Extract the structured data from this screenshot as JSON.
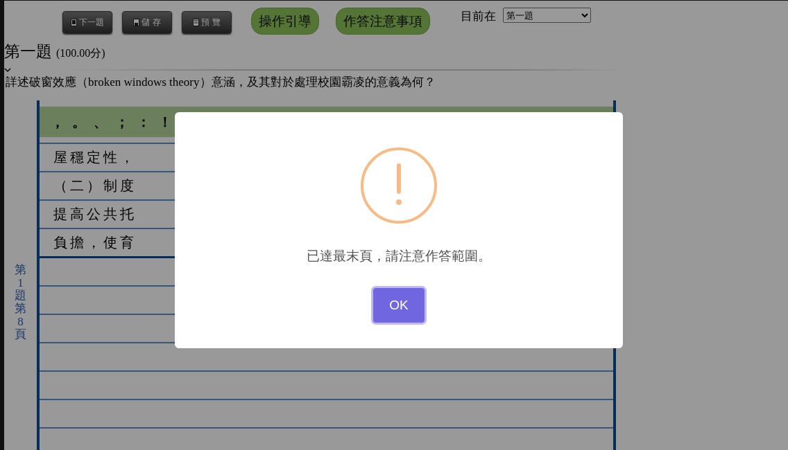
{
  "toolbar": {
    "buttons": [
      {
        "label": "下一題",
        "kind": "gray"
      },
      {
        "label": "儲 存",
        "kind": "gray"
      },
      {
        "label": "預 覽",
        "kind": "gray"
      },
      {
        "label": "操作引導",
        "kind": "green"
      },
      {
        "label": "作答注意事項",
        "kind": "green"
      }
    ],
    "location": {
      "label": "目前在",
      "value": "第一題"
    }
  },
  "question": {
    "title": "第一題",
    "score": "(100.00分)",
    "text": "詳述破窗效應（broken windows theory）意涵，及其對於處理校園霸凌的意義為何？"
  },
  "answer_sheet": {
    "side_label": "第1題第8頁",
    "punctuation": [
      "，",
      "。",
      "、",
      "；",
      "：",
      "！"
    ],
    "rows": [
      "屋穩定性，",
      "（二）制度",
      "提高公共托",
      "負擔，使育"
    ]
  },
  "dialog": {
    "message": "已達最末頁，請注意作答範圍。",
    "button": "OK"
  }
}
